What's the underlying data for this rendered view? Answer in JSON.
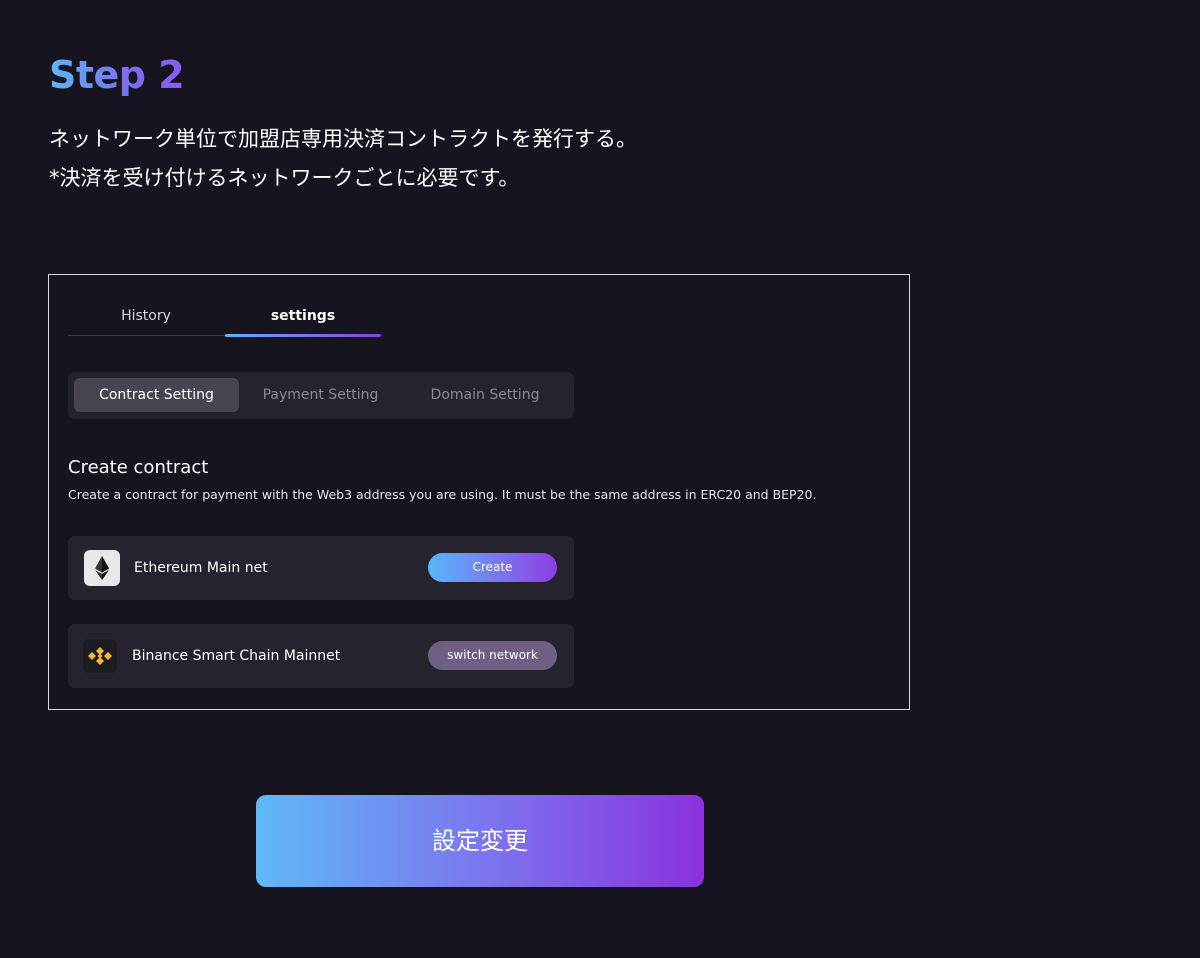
{
  "step": {
    "title": "Step 2",
    "description_lines": [
      "ネットワーク単位で加盟店専用決済コントラクトを発行する。",
      "*決済を受け付けるネットワークごとに必要です。"
    ]
  },
  "screenshot": {
    "tabs": [
      {
        "label": "History",
        "active": false
      },
      {
        "label": "settings",
        "active": true
      }
    ],
    "segments": [
      {
        "label": "Contract Setting",
        "active": true
      },
      {
        "label": "Payment Setting",
        "active": false
      },
      {
        "label": "Domain Setting",
        "active": false
      }
    ],
    "section": {
      "title": "Create contract",
      "description": "Create a contract for payment with the Web3 address you are using. It must be the same address in ERC20 and BEP20."
    },
    "networks": [
      {
        "name": "Ethereum Main net",
        "icon": "ethereum-icon",
        "button_label": "Create"
      },
      {
        "name": "Binance Smart Chain Mainnet",
        "icon": "binance-icon",
        "button_label": "switch network"
      }
    ]
  },
  "actions": {
    "submit_label": "設定変更"
  },
  "colors": {
    "background": "#16141f",
    "panel": "#26232f",
    "gradient_start": "#5bb8f7",
    "gradient_end": "#8a32de",
    "switch_button": "#6e5f84",
    "binance_yellow": "#f3ba2f"
  }
}
